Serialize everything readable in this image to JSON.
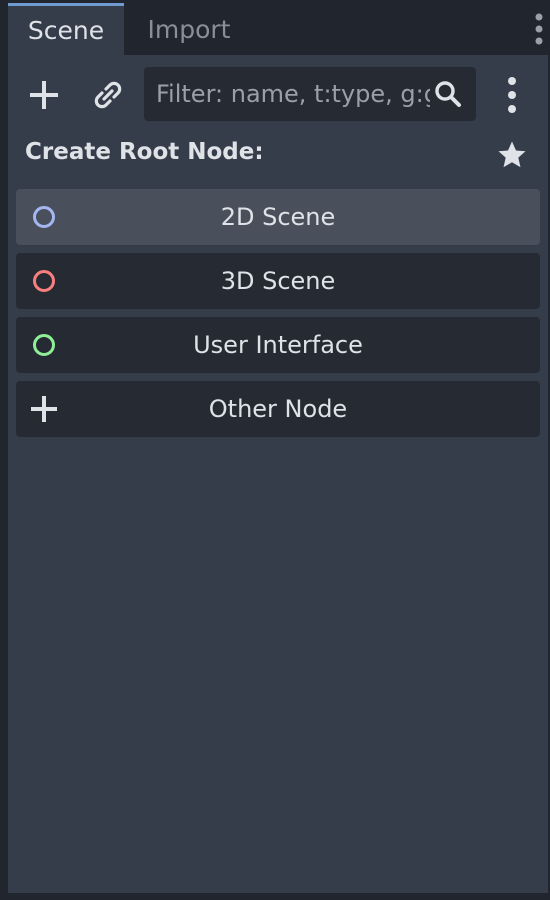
{
  "tabs": [
    {
      "label": "Scene",
      "active": true
    },
    {
      "label": "Import",
      "active": false
    }
  ],
  "toolbar": {
    "filter_placeholder": "Filter: name, t:type, g:group",
    "icons": [
      "add-icon",
      "link-icon",
      "search-icon",
      "kebab-menu-icon"
    ]
  },
  "create_root": {
    "label": "Create Root Node:",
    "favorite_icon": "star-icon",
    "options": [
      {
        "label": "2D Scene",
        "icon": "node2d-icon",
        "color": "#a5b7f3"
      },
      {
        "label": "3D Scene",
        "icon": "node3d-icon",
        "color": "#fc7f7f"
      },
      {
        "label": "User Interface",
        "icon": "control-icon",
        "color": "#8eef97"
      },
      {
        "label": "Other Node",
        "icon": "add-icon",
        "color": "#dfe2e7"
      }
    ]
  },
  "colors": {
    "accent": "#6f9bd1",
    "panel_bg": "#363d4a",
    "button_bg": "#262b33",
    "text": "#dfe2e7"
  }
}
